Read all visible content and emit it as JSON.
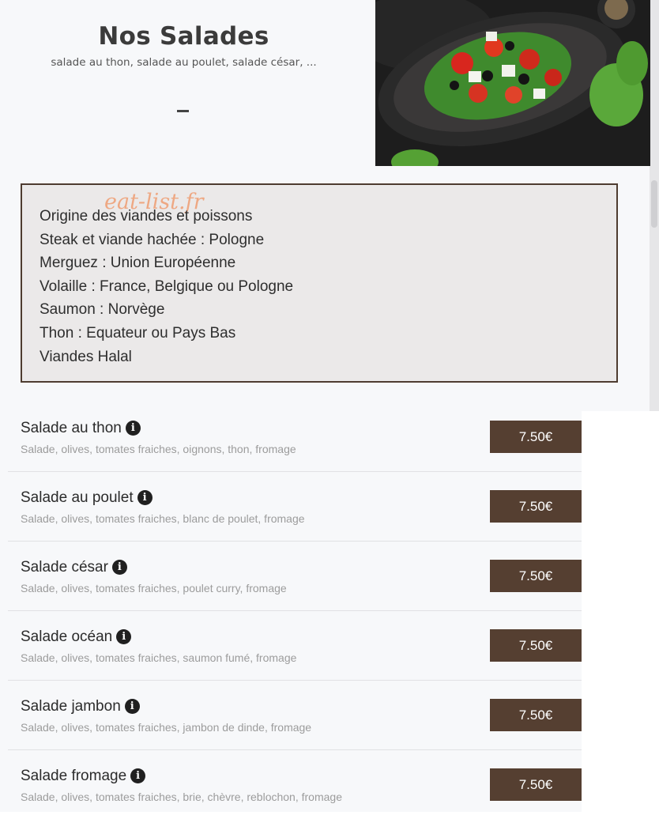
{
  "header": {
    "title": "Nos Salades",
    "subtitle": "salade au thon, salade au poulet, salade césar, ..."
  },
  "photo": {
    "subject": "greek-salad-plate-image"
  },
  "info_box": {
    "watermark": "eat-list.fr",
    "lines": [
      "Origine des viandes et poissons",
      "Steak et viande hachée : Pologne",
      "Merguez : Union Européenne",
      "Volaille : France, Belgique ou Pologne",
      "Saumon : Norvège",
      "Thon : Equateur ou Pays Bas",
      "Viandes Halal"
    ]
  },
  "menu": {
    "items": [
      {
        "name": "Salade au thon",
        "description": "Salade, olives, tomates fraiches, oignons, thon, fromage",
        "price": "7.50€"
      },
      {
        "name": "Salade au poulet",
        "description": "Salade, olives, tomates fraiches, blanc de poulet, fromage",
        "price": "7.50€"
      },
      {
        "name": "Salade césar",
        "description": "Salade, olives, tomates fraiches, poulet curry, fromage",
        "price": "7.50€"
      },
      {
        "name": "Salade océan",
        "description": "Salade, olives, tomates fraiches, saumon fumé, fromage",
        "price": "7.50€"
      },
      {
        "name": "Salade jambon",
        "description": "Salade, olives, tomates fraiches, jambon de dinde, fromage",
        "price": "7.50€"
      },
      {
        "name": "Salade fromage",
        "description": "Salade, olives, tomates fraiches, brie, chèvre, reblochon, fromage",
        "price": "7.50€"
      }
    ]
  },
  "colors": {
    "price_button_bg": "#553f31",
    "info_box_border": "#4e3c30",
    "watermark": "#ef9d72",
    "page_bg": "#f7f8fa"
  }
}
